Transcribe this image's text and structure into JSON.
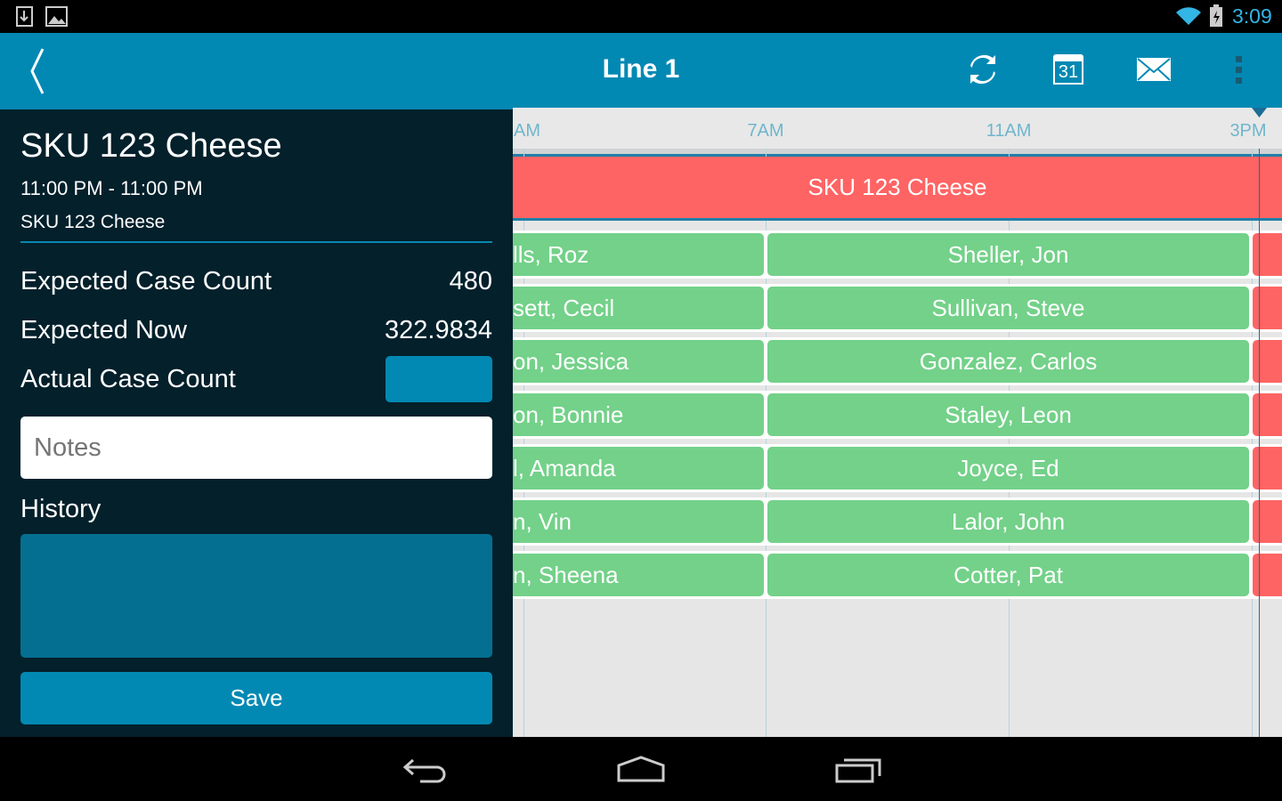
{
  "status_bar": {
    "time": "3:09",
    "icons": [
      "download-icon",
      "image-icon",
      "wifi-icon",
      "battery-charging-icon"
    ]
  },
  "action_bar": {
    "title": "Line 1",
    "icons": [
      "back-icon",
      "refresh-icon",
      "calendar-icon",
      "mail-icon",
      "overflow-menu-icon"
    ],
    "calendar_day": "31"
  },
  "detail": {
    "title": "SKU 123 Cheese",
    "time_range": "11:00 PM - 11:00 PM",
    "subtitle": "SKU 123 Cheese",
    "expected_case_count_label": "Expected Case Count",
    "expected_case_count": "480",
    "expected_now_label": "Expected Now",
    "expected_now": "322.9834",
    "actual_case_count_label": "Actual Case Count",
    "actual_case_count": "",
    "notes_placeholder": "Notes",
    "history_label": "History",
    "save_label": "Save"
  },
  "timeline": {
    "ticks": [
      "AM",
      "7AM",
      "11AM",
      "3PM"
    ],
    "product_bar": "SKU 123 Cheese",
    "rows": [
      {
        "left": "lls, Roz",
        "mid": "Sheller, Jon"
      },
      {
        "left": "sett, Cecil",
        "mid": "Sullivan, Steve"
      },
      {
        "left": "on, Jessica",
        "mid": "Gonzalez, Carlos"
      },
      {
        "left": "on, Bonnie",
        "mid": "Staley, Leon"
      },
      {
        "left": "l, Amanda",
        "mid": "Joyce, Ed"
      },
      {
        "left": "n, Vin",
        "mid": "Lalor, John"
      },
      {
        "left": "n, Sheena",
        "mid": "Cotter, Pat"
      }
    ]
  },
  "colors": {
    "accent": "#0289b3",
    "panel": "#03202b",
    "product": "#ff6464",
    "shift": "#73d189"
  }
}
